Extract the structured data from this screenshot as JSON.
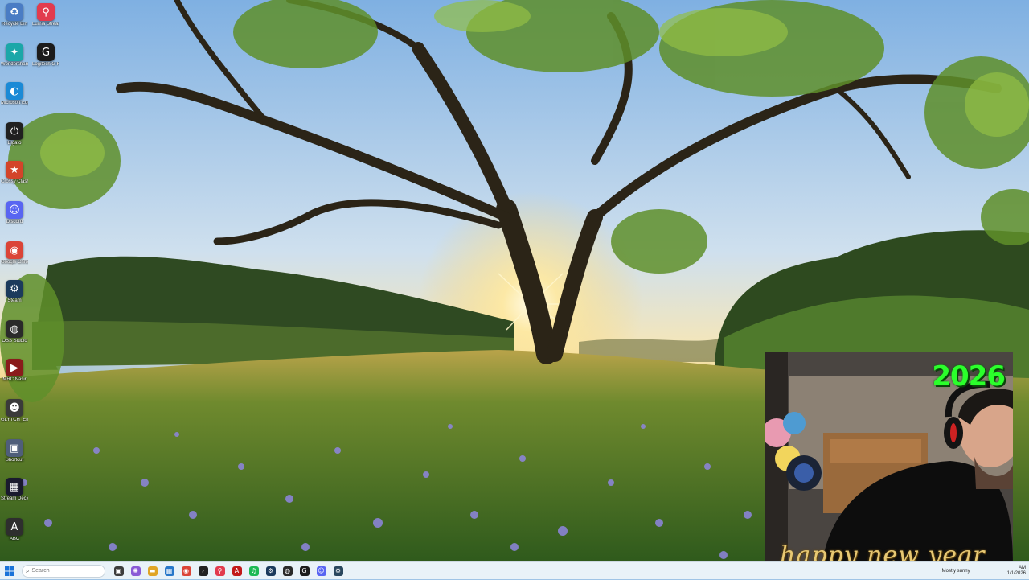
{
  "desktop": {
    "icons": [
      {
        "label": "Recycle Bin",
        "icon": "recycle-bin-icon",
        "glyph": "♻",
        "color": "#4a7cc4"
      },
      {
        "label": "Lumia Stream",
        "icon": "lumia-stream-icon",
        "glyph": "⚲",
        "color": "#e23b4e"
      },
      {
        "label": "Wondershare Mod Mania",
        "icon": "wondershare-icon",
        "glyph": "✦",
        "color": "#1aa7a8"
      },
      {
        "label": "Logitech G HUB",
        "icon": "logitech-ghub-icon",
        "glyph": "G",
        "color": "#1c1c1c"
      },
      {
        "label": "Microsoft Edge",
        "icon": "edge-icon",
        "glyph": "◐",
        "color": "#1b8ad6"
      },
      {
        "label": "Elgato",
        "icon": "elgato-icon",
        "glyph": "⏻",
        "color": "#202020"
      },
      {
        "label": "Crossy Clash",
        "icon": "game-icon",
        "glyph": "★",
        "color": "#d3442a"
      },
      {
        "label": "Discord",
        "icon": "discord-icon",
        "glyph": "☺",
        "color": "#5865f2"
      },
      {
        "label": "Google Chrome",
        "icon": "chrome-icon",
        "glyph": "◉",
        "color": "#db4437"
      },
      {
        "label": "Steam",
        "icon": "steam-icon",
        "glyph": "⚙",
        "color": "#1b3a5c"
      },
      {
        "label": "OBS Studio",
        "icon": "obs-studio-icon",
        "glyph": "◍",
        "color": "#2a2a2a"
      },
      {
        "label": "MRC Nasir",
        "icon": "media-icon",
        "glyph": "▶",
        "color": "#8a1b1b"
      },
      {
        "label": "GLYTCH_Emotes (1).webm",
        "icon": "video-file-icon",
        "glyph": "☻",
        "color": "#3a3a3a"
      },
      {
        "label": "Shortcut",
        "icon": "shortcut-icon",
        "glyph": "▣",
        "color": "#4f5e7a"
      },
      {
        "label": "Stream Deck",
        "icon": "stream-deck-icon",
        "glyph": "▦",
        "color": "#1a1a2e"
      },
      {
        "label": "ABC",
        "icon": "font-icon",
        "glyph": "A",
        "color": "#2e2e2e"
      }
    ]
  },
  "webcam": {
    "year": "2026",
    "greeting": "happy new year"
  },
  "taskbar": {
    "start_icon": "windows-start-icon",
    "search": {
      "placeholder": "Search"
    },
    "apps": [
      {
        "name": "task-view",
        "glyph": "▣",
        "color": "#3d3d3d"
      },
      {
        "name": "copilot",
        "glyph": "✺",
        "color": "#8a5bd6"
      },
      {
        "name": "file-explorer",
        "glyph": "▬",
        "color": "#e0a526"
      },
      {
        "name": "microsoft-store",
        "glyph": "▦",
        "color": "#2877c9"
      },
      {
        "name": "chrome",
        "glyph": "◉",
        "color": "#db4437"
      },
      {
        "name": "terminal",
        "glyph": "›",
        "color": "#222222"
      },
      {
        "name": "lumia",
        "glyph": "⚲",
        "color": "#e23b4e"
      },
      {
        "name": "adobe",
        "glyph": "A",
        "color": "#c21a1a"
      },
      {
        "name": "spotify",
        "glyph": "♫",
        "color": "#1db954"
      },
      {
        "name": "steam",
        "glyph": "⚙",
        "color": "#1b3a5c"
      },
      {
        "name": "obs",
        "glyph": "◍",
        "color": "#2a2a2a"
      },
      {
        "name": "logitech",
        "glyph": "G",
        "color": "#1c1c1c"
      },
      {
        "name": "discord",
        "glyph": "☺",
        "color": "#5865f2"
      },
      {
        "name": "steam-2",
        "glyph": "⚙",
        "color": "#2a475e"
      }
    ],
    "weather": "Mostly sunny",
    "time": "AM",
    "date": "1/1/2026"
  }
}
